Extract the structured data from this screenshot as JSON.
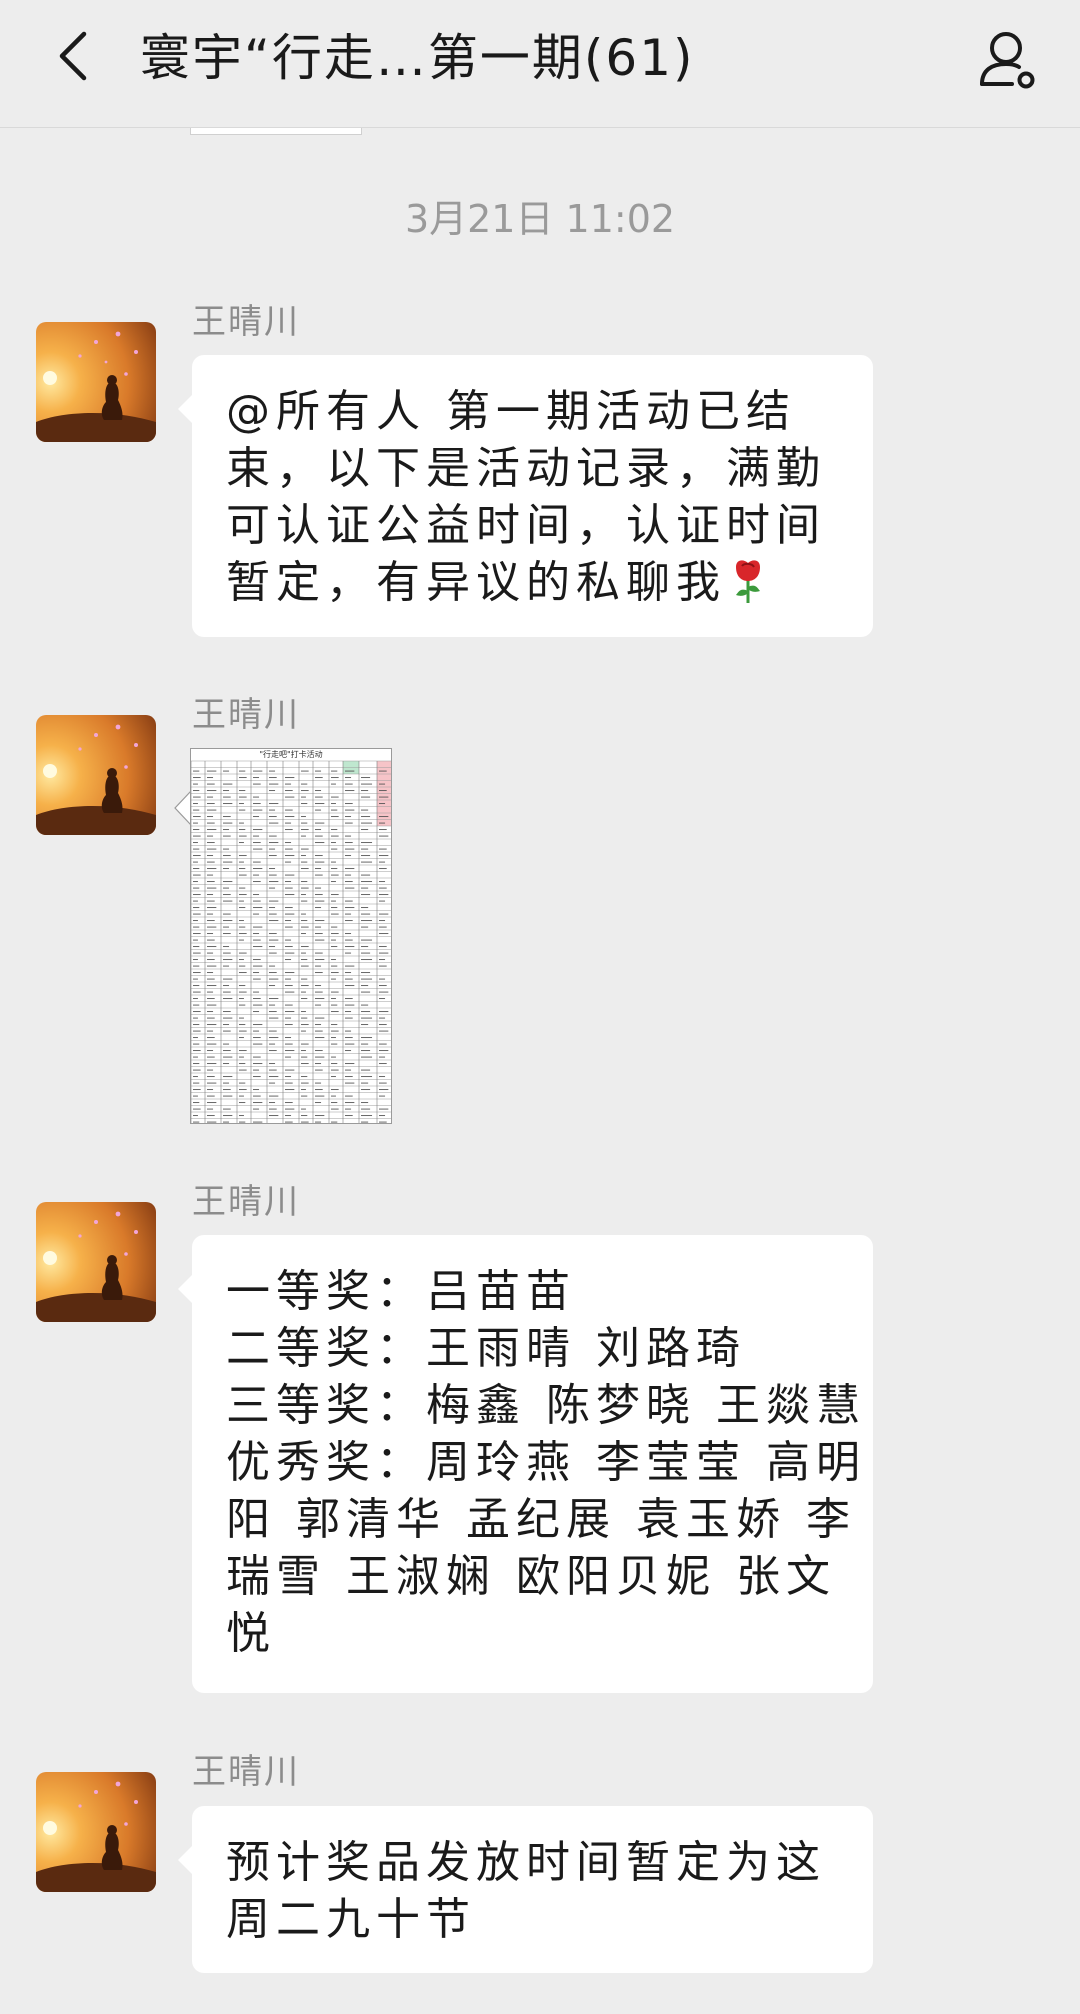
{
  "header": {
    "title": "寰宇“行走…第一期(61)",
    "back_icon": "chevron-left-icon",
    "profile_icon": "group-profile-icon"
  },
  "timestamp": "3月21日 11:02",
  "messages": [
    {
      "sender": "王晴川",
      "type": "text",
      "lines": [
        "@所有人 第一期活动已结",
        "束，以下是活动记录，满勤",
        "可认证公益时间，认证时间",
        "暂定，有异议的私聊我"
      ],
      "emoji": "rose-icon"
    },
    {
      "sender": "王晴川",
      "type": "image",
      "image_title": "\"行走吧\"打卡活动"
    },
    {
      "sender": "王晴川",
      "type": "text",
      "lines": [
        "一等奖：吕苗苗",
        "二等奖：王雨晴 刘路琦",
        "三等奖：梅鑫 陈梦晓 王燚慧",
        "优秀奖：周玲燕 李莹莹 高明",
        "阳 郭清华 孟纪展 袁玉娇 李",
        "瑞雪 王淑娴 欧阳贝妮 张文",
        "悦"
      ]
    },
    {
      "sender": "王晴川",
      "type": "text",
      "lines": [
        "预计奖品发放时间暂定为这",
        "周二九十节"
      ]
    }
  ]
}
